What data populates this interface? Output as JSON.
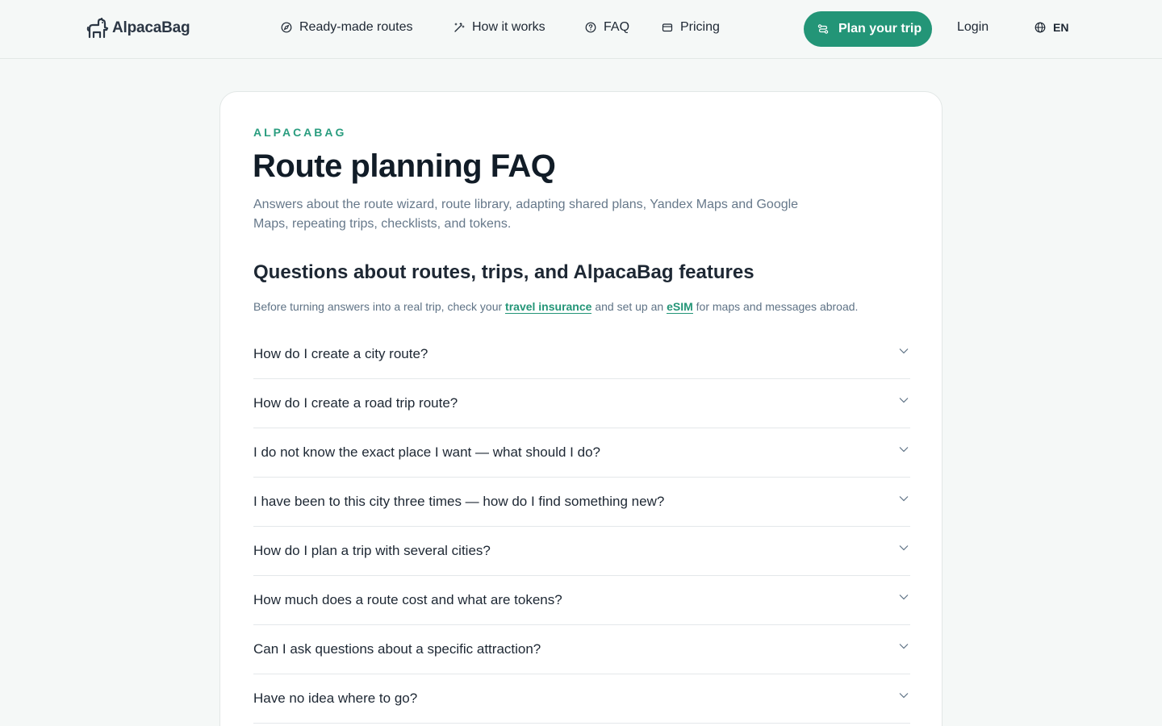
{
  "brand": {
    "name": "AlpacaBag",
    "accent": "#239577"
  },
  "nav": {
    "items": [
      {
        "label": "Ready-made routes",
        "icon": "compass-icon"
      },
      {
        "label": "How it works",
        "icon": "magic-wand-icon"
      },
      {
        "label": "FAQ",
        "icon": "question-circle-icon"
      },
      {
        "label": "Pricing",
        "icon": "wallet-icon"
      }
    ],
    "cta_label": "Plan your trip",
    "cta_icon": "route-icon",
    "login_label": "Login",
    "lang_label": "EN",
    "lang_icon": "globe-icon"
  },
  "page": {
    "eyebrow": "ALPACABAG",
    "title": "Route planning FAQ",
    "subtitle": "Answers about the route wizard, route library, adapting shared plans, Yandex Maps and Google Maps, repeating trips, checklists, and tokens.",
    "section_title": "Questions about routes, trips, and AlpacaBag features",
    "notice": {
      "before": "Before turning answers into a real trip, check your ",
      "link1": "travel insurance",
      "middle": " and set up an ",
      "link2": "eSIM",
      "after": " for maps and messages abroad."
    }
  },
  "faq": [
    "How do I create a city route?",
    "How do I create a road trip route?",
    "I do not know the exact place I want — what should I do?",
    "I have been to this city three times — how do I find something new?",
    "How do I plan a trip with several cities?",
    "How much does a route cost and what are tokens?",
    "Can I ask questions about a specific attraction?",
    "Have no idea where to go?"
  ]
}
